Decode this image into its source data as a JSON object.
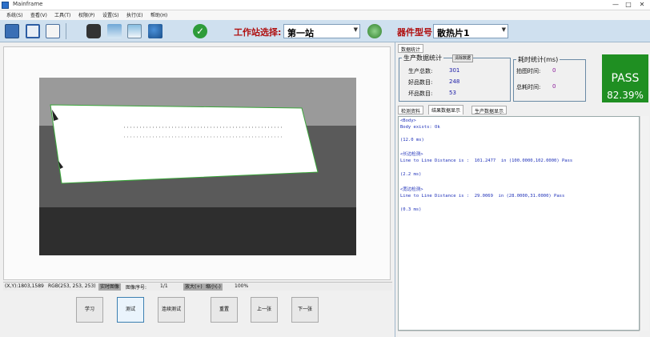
{
  "window": {
    "title": "Mainframe",
    "minimize": "—",
    "restore": "□",
    "close": "✕"
  },
  "menu": [
    "系统(S)",
    "查看(V)",
    "工具(T)",
    "权限(P)",
    "设置(S)",
    "执行(E)",
    "帮助(H)"
  ],
  "toolbar": {
    "station_label": "工作站选择:",
    "station_value": "第一站",
    "model_label": "器件型号:",
    "model_value": "散热片1",
    "icons": [
      "open-icon",
      "save-icon",
      "edit-icon",
      "camera-icon",
      "image-icon",
      "gallery-icon",
      "users-icon",
      "confirm-icon",
      "refresh-icon"
    ]
  },
  "status": {
    "xy": "(X,Y):1803,1589",
    "rgb": "RGB(253, 253, 253)",
    "mode": "实时图像",
    "image_count_label": "图像序号:",
    "image_count": "1/1",
    "zoom_in": "放大(+)",
    "zoom_out": "缩小(-)",
    "zoom": "100%"
  },
  "buttons": {
    "learn": "学习",
    "test": "测试",
    "continuous_test": "连续测试",
    "reset": "重置",
    "prev": "上一张",
    "next": "下一张"
  },
  "right": {
    "top_tab": "数据统计",
    "production": {
      "title": "生产数据统计",
      "clear_btn": "清除数据",
      "total_label": "生产总数:",
      "total": "301",
      "good_label": "好品数目:",
      "good": "248",
      "bad_label": "坏品数目:",
      "bad": "53"
    },
    "timing": {
      "title": "耗时统计(ms)",
      "capture_label": "拍图时间:",
      "capture": "0",
      "total_label": "总耗时间:",
      "total": "0"
    },
    "result": {
      "status": "PASS",
      "rate": "82.39%"
    },
    "tabs": [
      "检测资料",
      "结果数据显示",
      "生产数据显示"
    ],
    "log": [
      "<Body>",
      "Body exists: Ok",
      "",
      "(12.0 ms)",
      "",
      "<长边检测>",
      "Line to Line Distance is :  101.2477  in (100.0000,102.0000) Pass",
      "",
      "(2.2 ms)",
      "",
      "<宽边检测>",
      "Line to Line Distance is :  29.0069  in (28.0000,31.0000) Pass",
      "",
      "(0.3 ms)"
    ]
  },
  "colors": {
    "pass_bg": "#1f8f22",
    "toolbar_bg": "#cfe0ef",
    "label_red": "#b01010"
  }
}
